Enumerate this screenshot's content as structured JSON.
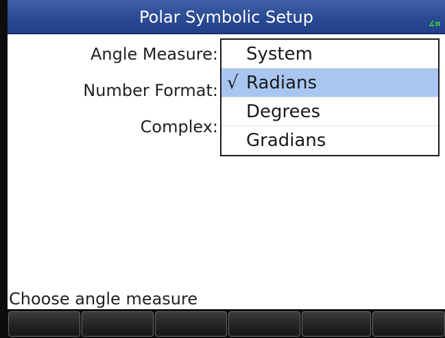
{
  "title": "Polar Symbolic Setup",
  "status_indicator": "∡π",
  "form": {
    "angle_label": "Angle Measure:",
    "number_label": "Number Format:",
    "complex_label": "Complex:"
  },
  "dropdown": {
    "items": [
      {
        "label": "System",
        "checked": false
      },
      {
        "label": "Radians",
        "checked": true
      },
      {
        "label": "Degrees",
        "checked": false
      },
      {
        "label": "Gradians",
        "checked": false
      }
    ],
    "checkmark": "√"
  },
  "status": "Choose angle measure",
  "colors": {
    "titlebar": "#2a4a93",
    "selection": "#a9c6f1",
    "indicator": "#3cd23c"
  }
}
